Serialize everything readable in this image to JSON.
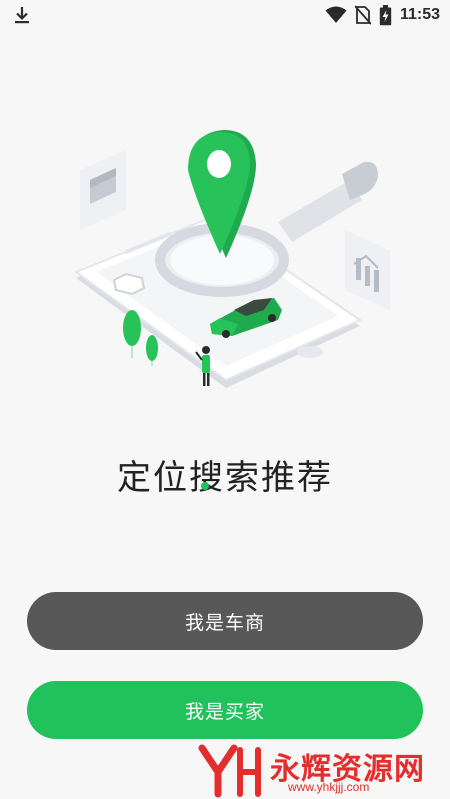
{
  "status_bar": {
    "time": "11:53",
    "icons": [
      "download-icon",
      "wifi-icon",
      "no-sim-icon",
      "battery-charging-icon"
    ]
  },
  "onboarding": {
    "headline": "定位搜索推荐",
    "illustration": "map-pin-phone-car-illustration",
    "pagination": {
      "current": 1
    }
  },
  "buttons": {
    "dealer_label": "我是车商",
    "buyer_label": "我是买家"
  },
  "watermark": {
    "title": "永辉资源网",
    "url": "www.yhkjjj.com"
  },
  "colors": {
    "accent": "#21c25b",
    "dark_button": "#585858",
    "watermark": "#e42d2d",
    "background": "#f7f7f7"
  }
}
